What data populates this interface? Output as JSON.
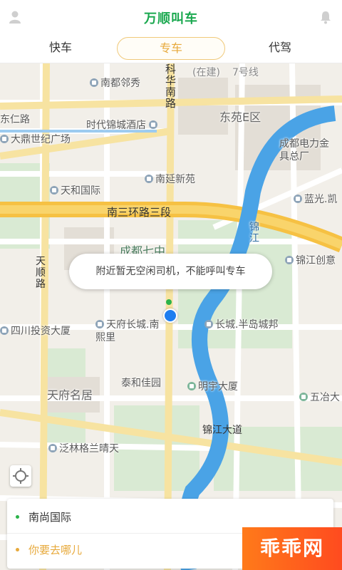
{
  "header": {
    "title": "万顺叫车",
    "user_icon": "user-icon",
    "bell_icon": "bell-icon"
  },
  "tabs": [
    {
      "label": "快车",
      "active": false
    },
    {
      "label": "专车",
      "active": true
    },
    {
      "label": "代驾",
      "active": false
    }
  ],
  "map": {
    "labels": {
      "nandulinxiu": "南都邻秀",
      "kehua_nan": "科华南路",
      "zaijian": "(在建)",
      "line7": "7号线",
      "dongyuan": "东苑E区",
      "renlu": "东仁路",
      "shidai": "时代锦城酒店",
      "dading": "大鼎世纪广场",
      "chengdu_dianli": "成都电力金具总厂",
      "nanyan": "南延新苑",
      "tianhe": "天和国际",
      "languang": "蓝光.凯",
      "ring_road": "南三环路三段",
      "jinjiang": "锦江",
      "cd7": "成都七中",
      "jinjiang_chuangyi": "锦江创意",
      "tianshun": "天顺路",
      "sichuan": "四川投资大厦",
      "tianfu_changcheng": "天府长城.南熙里",
      "changcheng_bandao": "长城.半岛城邦",
      "taihe": "泰和佳园",
      "mingyu": "明宇大厦",
      "tianfu_mingju": "天府名居",
      "wuye": "五冶大",
      "jinjiang_dadao": "锦江大道",
      "fanlin": "泛林格兰晴天"
    },
    "tooltip": "附近暂无空闲司机，不能呼叫专车"
  },
  "panel": {
    "start": "南尚国际",
    "destination_placeholder": "你要去哪儿"
  },
  "watermark": "乖乖网",
  "colors": {
    "accent_green": "#1aa84f",
    "accent_orange": "#e7a93b",
    "ring_road": "#f6c143",
    "river": "#4aa3e6"
  }
}
